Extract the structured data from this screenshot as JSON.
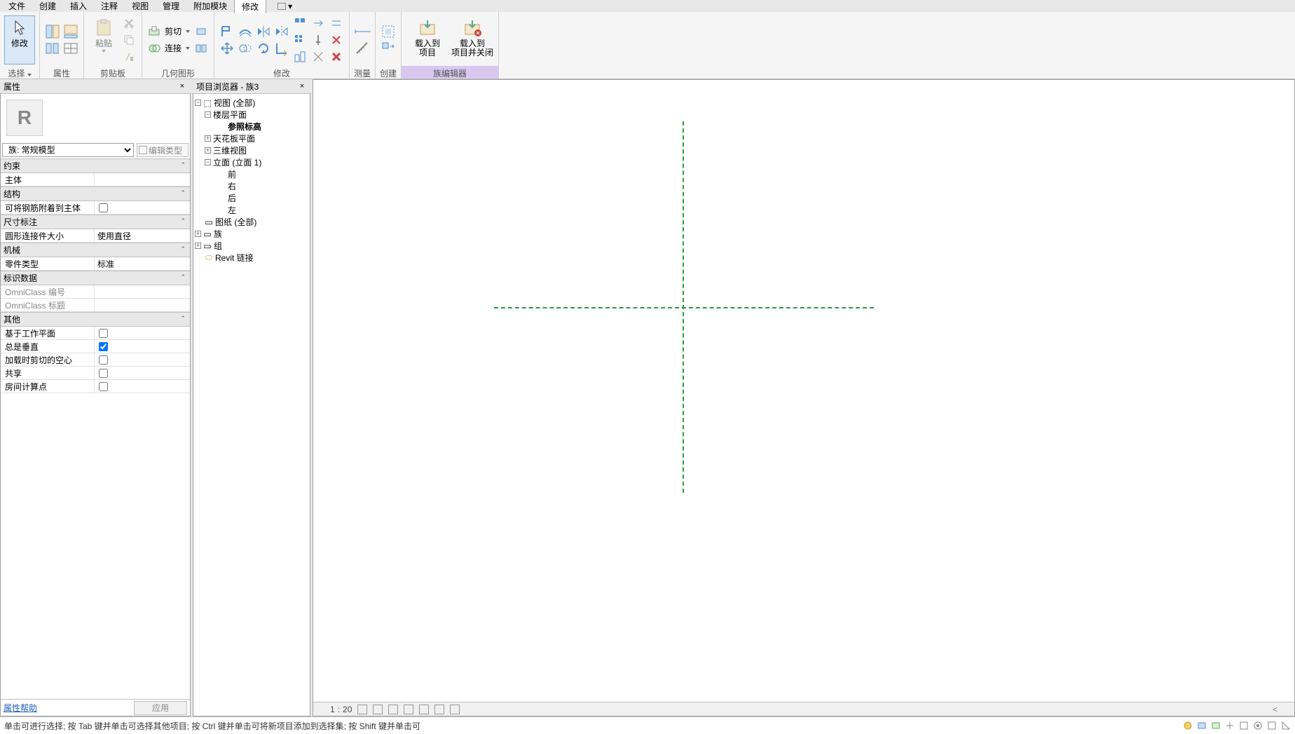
{
  "menu": {
    "items": [
      "文件",
      "创建",
      "插入",
      "注释",
      "视图",
      "管理",
      "附加模块",
      "修改"
    ],
    "active_index": 7
  },
  "ribbon": {
    "select": {
      "modify": "修改",
      "select_lbl": "选择"
    },
    "properties": {
      "group_lbl": "属性"
    },
    "clipboard": {
      "paste": "粘贴",
      "group_lbl": "剪贴板"
    },
    "geometry": {
      "cut": "剪切",
      "join": "连接",
      "group_lbl": "几何图形"
    },
    "modify": {
      "group_lbl": "修改"
    },
    "measure": {
      "group_lbl": "测量"
    },
    "create": {
      "group_lbl": "创建"
    },
    "family": {
      "load_proj": "载入到\n项目",
      "load_close": "载入到\n项目并关闭",
      "group_lbl": "族编辑器"
    }
  },
  "prop": {
    "title": "属性",
    "type_selector": "族: 常规模型",
    "edit_type": "编辑类型",
    "cats": {
      "constraint": "约束",
      "structure": "结构",
      "dims": "尺寸标注",
      "mech": "机械",
      "ident": "标识数据",
      "other": "其他"
    },
    "rows": {
      "host": "主体",
      "rebar_host": "可将钢筋附着到主体",
      "conn_size": {
        "k": "圆形连接件大小",
        "v": "使用直径"
      },
      "part_type": {
        "k": "零件类型",
        "v": "标准"
      },
      "omni_num": "OmniClass 编号",
      "omni_title": "OmniClass 标题",
      "workplane": "基于工作平面",
      "always_vert": "总是垂直",
      "cut_voids": "加载时剪切的空心",
      "shared": "共享",
      "room_calc": "房间计算点"
    },
    "help": "属性帮助",
    "apply": "应用"
  },
  "browser": {
    "title": "项目浏览器 - 族3",
    "nodes": {
      "views": "视图 (全部)",
      "floor_plans": "楼层平面",
      "ref_level": "参照标高",
      "ceiling_plans": "天花板平面",
      "3d_views": "三维视图",
      "elevations": "立面 (立面 1)",
      "front": "前",
      "right": "右",
      "back": "后",
      "left": "左",
      "sheets": "图纸 (全部)",
      "families": "族",
      "groups": "组",
      "revit_links": "Revit 链接"
    }
  },
  "view_ctrl": {
    "scale_num": "1",
    "scale_den": "20"
  },
  "statusbar": {
    "hint": "单击可进行选择; 按 Tab 键并单击可选择其他项目; 按 Ctrl 键并单击可将新项目添加到选择集; 按 Shift 键并单击可"
  }
}
